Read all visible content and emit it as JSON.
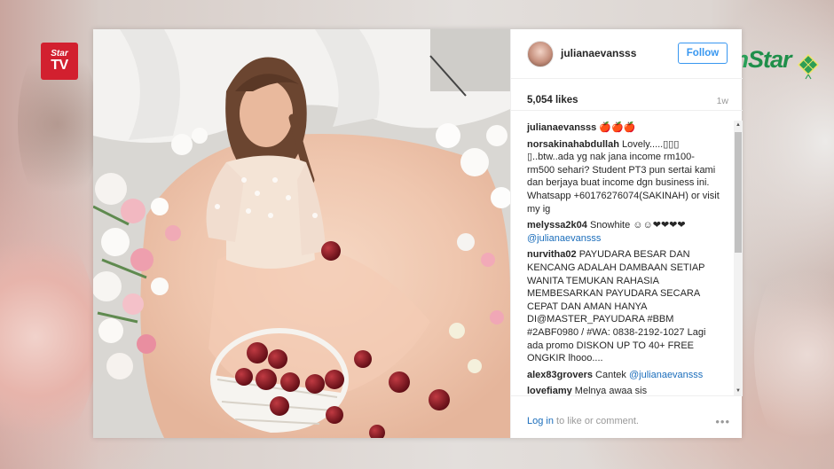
{
  "branding": {
    "star_tv_line1": "Star",
    "star_tv_line2": "TV",
    "mstar_m": "m",
    "mstar_rest": "Star",
    "star_tv_color": "#d2202f",
    "mstar_color": "#1f8f4a"
  },
  "post": {
    "username": "julianaevansss",
    "follow_label": "Follow",
    "likes": "5,054 likes",
    "age": "1w",
    "login_link": "Log in",
    "login_rest": " to like or comment.",
    "more_icon": "•••",
    "accent_color": "#3897f0"
  },
  "comments": [
    {
      "author": "julianaevansss",
      "text": " 🍎🍎🍎",
      "link": ""
    },
    {
      "author": "norsakinahabdullah",
      "text": " Lovely.....▯▯▯ ▯..btw..ada yg nak jana income rm100-rm500 sehari? Student PT3 pun sertai kami dan berjaya buat income dgn business ini. Whatsapp +60176276074(SAKINAH) or visit my ig",
      "link": ""
    },
    {
      "author": "melyssa2k04",
      "text": " Snowhite ☺☺❤❤❤❤ ",
      "link": "@julianaevansss"
    },
    {
      "author": "nurvitha02",
      "text": " PAYUDARA BESAR DAN KENCANG ADALAH DAMBAAN SETIAP WANITA TEMUKAN RAHASIA MEMBESARKAN PAYUDARA SECARA CEPAT DAN AMAN HANYA DI@MASTER_PAYUDARA #BBM #2ABF0980 / #WA: 0838-2192-1027 Lagi ada promo DISKON UP TO 40+ FREE ONGKIR lhooo....",
      "link": ""
    },
    {
      "author": "alex83grovers",
      "text": " Cantek ",
      "link": "@julianaevansss"
    },
    {
      "author": "lovefiamy",
      "text": " Melnya awaa sis",
      "link": ""
    }
  ]
}
